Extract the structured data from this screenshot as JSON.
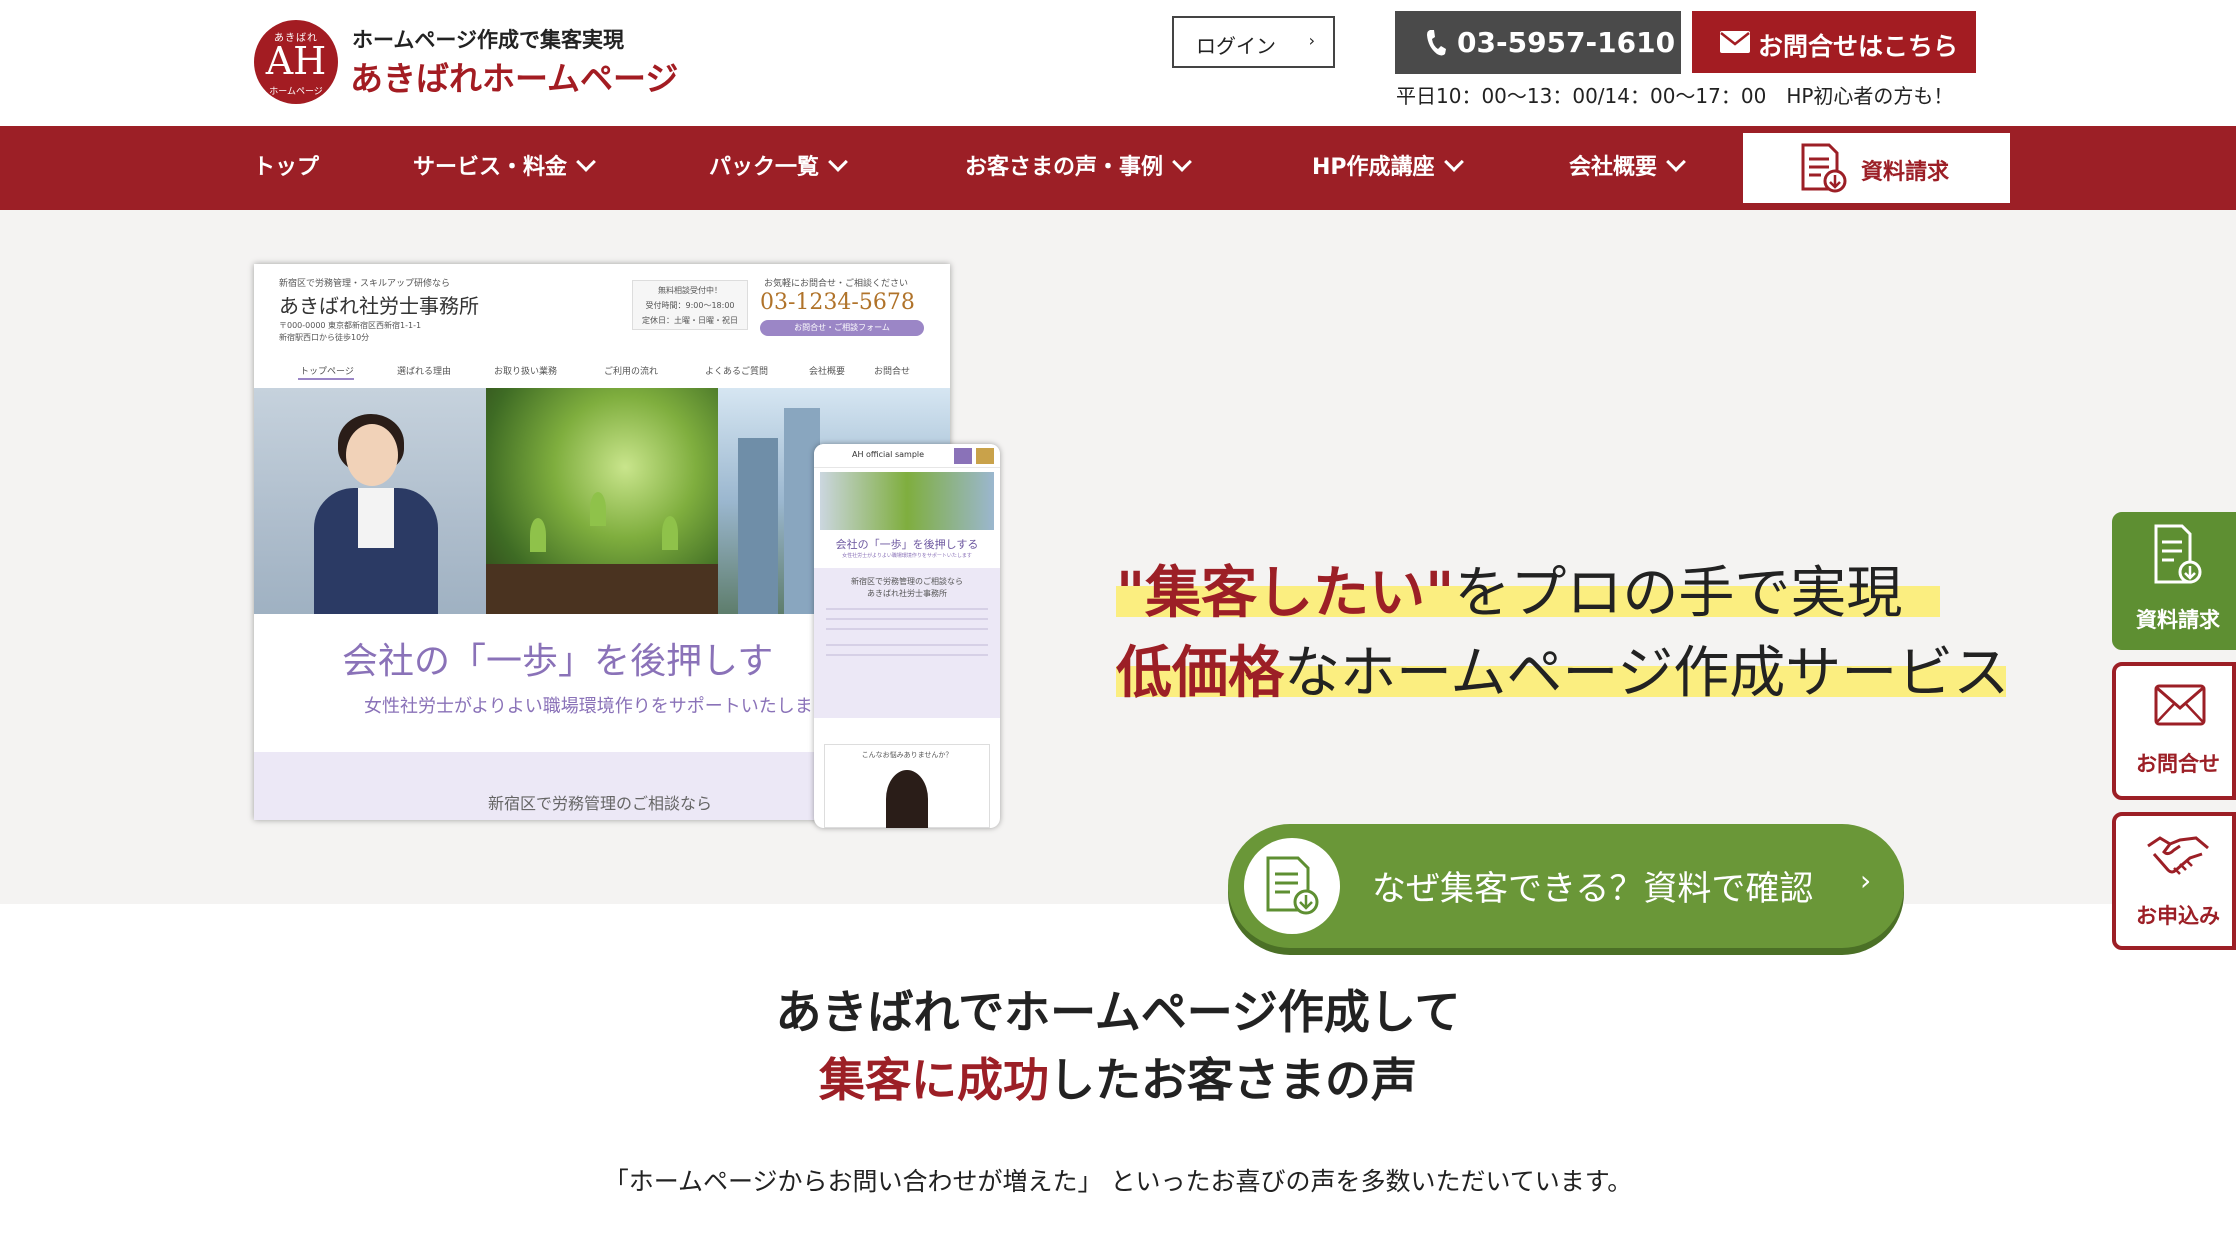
{
  "brand": {
    "logo_top": "あきばれ",
    "logo_mark": "AH",
    "logo_bottom": "ホームページ",
    "tagline": "ホームページ作成で集客実現",
    "name": "あきばれホームページ"
  },
  "header": {
    "login_label": "ログイン",
    "phone": "03-5957-1610",
    "contact_label": "お問合せはこちら",
    "hours": "平日10：00～13：00/14：00～17：00　HP初心者の方も！"
  },
  "nav": {
    "items": [
      {
        "label": "トップ"
      },
      {
        "label": "サービス・料金"
      },
      {
        "label": "パック一覧"
      },
      {
        "label": "お客さまの声・事例"
      },
      {
        "label": "HP作成講座"
      },
      {
        "label": "会社概要"
      }
    ],
    "doc_request": "資料請求"
  },
  "mock_desktop": {
    "tiny": "新宿区で労務管理・スキルアップ研修なら",
    "title": "あきばれ社労士事務所",
    "addr1": "〒000-0000 東京都新宿区西新宿1-1-1",
    "addr2": "新宿駅西口から徒歩10分",
    "hours_title": "無料相談受付中！",
    "hours_line1": "受付時間：9:00～18:00",
    "hours_line2": "定休日：土曜・日曜・祝日",
    "contact_note": "お気軽にお問合せ・ご相談ください",
    "phone": "03-1234-5678",
    "form_btn": "お問合せ・ご相談フォーム",
    "nav": [
      "トップページ",
      "選ばれる理由",
      "お取り扱い業務",
      "ご利用の流れ",
      "よくあるご質問",
      "会社概要",
      "お問合せ"
    ],
    "headline": "会社の「一歩」を後押しす",
    "subline": "女性社労士がよりよい職場環境作りをサポートいたしま",
    "foot": "新宿区で労務管理のご相談なら"
  },
  "mock_phone": {
    "title": "AH official sample",
    "headline": "会社の「一歩」を後押しする",
    "subline": "女性社労士がよりよい職場環境作りをサポートいたします",
    "box_line1": "新宿区で労務管理のご相談なら",
    "box_line2": "あきばれ社労士事務所",
    "card_title": "こんなお悩みありませんか？"
  },
  "hero": {
    "line1_accent": "\"集客したい\"",
    "line1_rest": "をプロの手で実現",
    "line2_accent": "低価格",
    "line2_rest": "なホームページ作成サービス",
    "cta_label": "なぜ集客できる？資料で確認",
    "cta_chevron": "›"
  },
  "side_tabs": {
    "doc": "資料請求",
    "mail": "お問合せ",
    "apply": "お申込み"
  },
  "voices": {
    "heading_line1": "あきばれでホームページ作成して",
    "heading_line2_accent": "集客に成功",
    "heading_line2_rest": "したお客さまの声",
    "lead": "「ホームページからお問い合わせが増えた」 といったお喜びの声を多数いただいています。"
  },
  "colors": {
    "brand_red": "#9c1f26",
    "dark_gray": "#4a4a4a",
    "cta_green": "#6a9738",
    "highlight_yellow": "#fbee80",
    "hero_bg": "#f4f3f2"
  },
  "icons": [
    "phone-icon",
    "mail-icon",
    "document-download-icon",
    "handshake-icon",
    "chevron-right-icon",
    "chevron-down-icon"
  ]
}
